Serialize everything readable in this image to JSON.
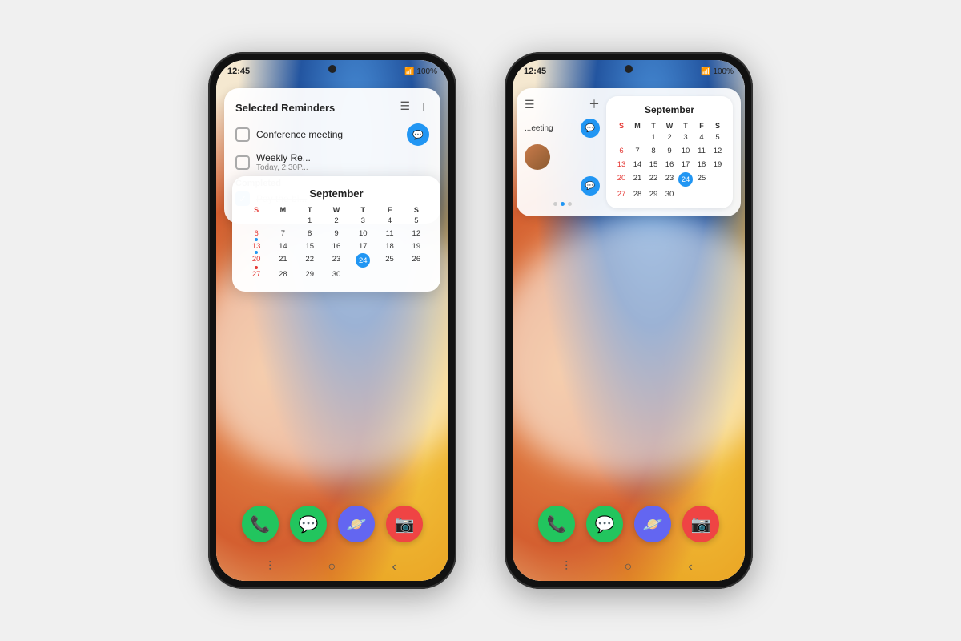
{
  "phones": [
    {
      "id": "phone-left",
      "status": {
        "time": "12:45",
        "battery": "100%",
        "signal": "●●●",
        "wifi": "wifi"
      },
      "widget": {
        "title": "Selected Reminders",
        "items": [
          {
            "id": 1,
            "text": "Conference meeting",
            "checked": false,
            "badge": true,
            "sub": ""
          },
          {
            "id": 2,
            "text": "Weekly Re...",
            "checked": false,
            "badge": false,
            "sub": "Today, 2:30P..."
          }
        ],
        "completed_label": "Completed",
        "completed_items": [
          {
            "id": 3,
            "text": "Pay the bi...",
            "checked": true
          }
        ]
      },
      "calendar": {
        "month": "September",
        "headers": [
          "S",
          "M",
          "T",
          "W",
          "T",
          "F",
          "S"
        ],
        "weeks": [
          [
            "",
            "",
            "1",
            "2",
            "3",
            "4",
            "5"
          ],
          [
            "6",
            "7",
            "8",
            "9",
            "10",
            "11",
            "12"
          ],
          [
            "13",
            "14",
            "15",
            "16",
            "17",
            "18",
            "19"
          ],
          [
            "20",
            "21",
            "22",
            "23",
            "24",
            "25",
            "26"
          ],
          [
            "27",
            "28",
            "29",
            "30",
            "",
            "",
            ""
          ]
        ],
        "today": "24",
        "event_dots": [
          "6",
          "13",
          "20"
        ]
      },
      "dock": [
        {
          "icon": "📞",
          "color": "#22c55e",
          "name": "Phone"
        },
        {
          "icon": "💬",
          "color": "#22c55e",
          "name": "Chat"
        },
        {
          "icon": "🪐",
          "color": "#6366f1",
          "name": "Planet"
        },
        {
          "icon": "📷",
          "color": "#ef4444",
          "name": "Camera"
        }
      ],
      "nav": [
        "⫶",
        "○",
        "‹"
      ]
    },
    {
      "id": "phone-right",
      "status": {
        "time": "12:45",
        "battery": "100%"
      },
      "widget_left": {
        "header_icons": [
          "list",
          "plus"
        ],
        "items": [
          {
            "text": "...eeting",
            "badge": true
          },
          {
            "has_avatar": true,
            "badge": false
          },
          {
            "text": "",
            "badge": true
          }
        ],
        "dots": [
          false,
          true,
          false
        ]
      },
      "widget_right": {
        "month": "September",
        "headers": [
          "S",
          "M",
          "T",
          "W",
          "T",
          "F"
        ],
        "weeks": [
          [
            "",
            "1",
            "2",
            "3",
            "4"
          ],
          [
            "6",
            "7",
            "8",
            "9",
            "10",
            "11"
          ],
          [
            "13",
            "14",
            "15",
            "16",
            "17",
            "18"
          ],
          [
            "20",
            "21",
            "22",
            "23",
            "24",
            "25"
          ],
          [
            "27",
            "28",
            "29",
            "30",
            "",
            ""
          ]
        ],
        "today": "24"
      },
      "dock": [
        {
          "icon": "📞",
          "color": "#22c55e",
          "name": "Phone"
        },
        {
          "icon": "💬",
          "color": "#22c55e",
          "name": "Chat"
        },
        {
          "icon": "🪐",
          "color": "#6366f1",
          "name": "Planet"
        },
        {
          "icon": "📷",
          "color": "#ef4444",
          "name": "Camera"
        }
      ],
      "nav": [
        "⫶",
        "○",
        "‹"
      ]
    }
  ]
}
